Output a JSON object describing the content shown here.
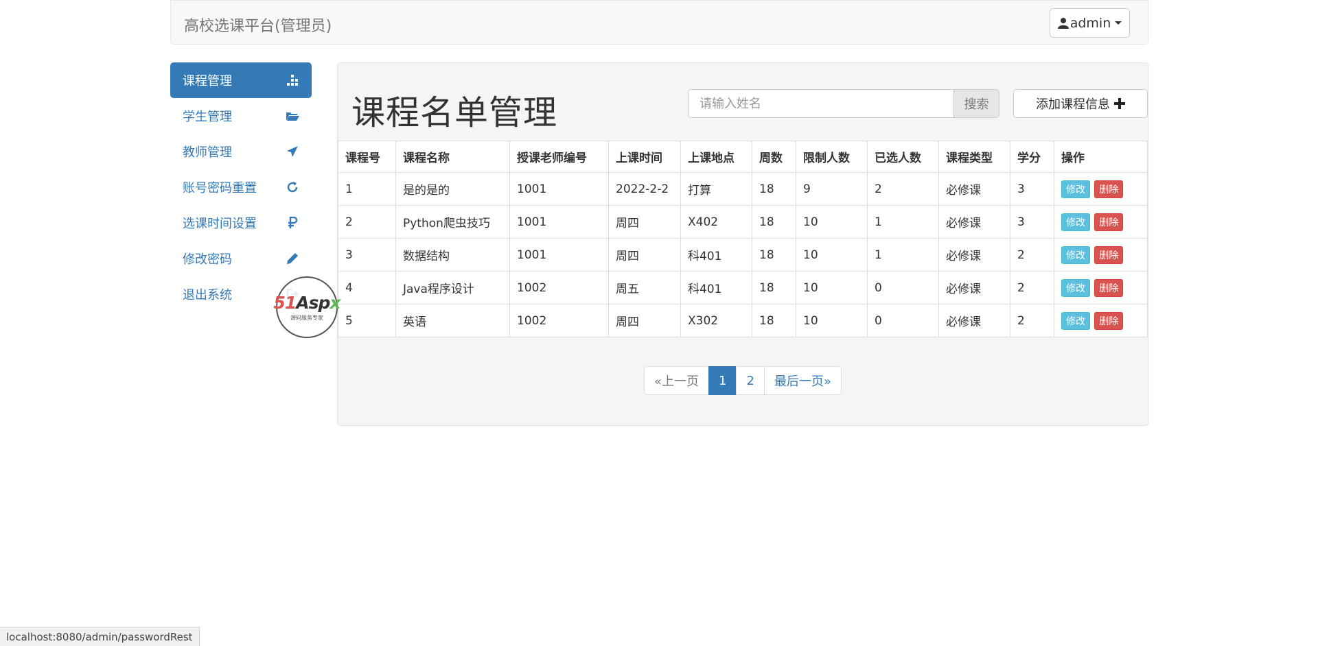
{
  "navbar": {
    "brand": "高校选课平台(管理员)",
    "user_label": "admin"
  },
  "sidebar": {
    "items": [
      {
        "label": "课程管理",
        "icon": "sitemap-icon",
        "active": true
      },
      {
        "label": "学生管理",
        "icon": "folder-open-icon"
      },
      {
        "label": "教师管理",
        "icon": "send-icon"
      },
      {
        "label": "账号密码重置",
        "icon": "refresh-icon"
      },
      {
        "label": "选课时间设置",
        "icon": "ruble-icon"
      },
      {
        "label": "修改密码",
        "icon": "pencil-icon"
      },
      {
        "label": "退出系统",
        "icon": "log-out-icon"
      }
    ]
  },
  "main": {
    "title": "课程名单管理",
    "search": {
      "placeholder": "请输入姓名",
      "value": "",
      "button": "搜索"
    },
    "add_button": "添加课程信息",
    "table": {
      "headers": [
        "课程号",
        "课程名称",
        "授课老师编号",
        "上课时间",
        "上课地点",
        "周数",
        "限制人数",
        "已选人数",
        "课程类型",
        "学分",
        "操作"
      ],
      "rows": [
        [
          "1",
          "是的是的",
          "1001",
          "2022-2-2",
          "打算",
          "18",
          "9",
          "2",
          "必修课",
          "3"
        ],
        [
          "2",
          "Python爬虫技巧",
          "1001",
          "周四",
          "X402",
          "18",
          "10",
          "1",
          "必修课",
          "3"
        ],
        [
          "3",
          "数据结构",
          "1001",
          "周四",
          "科401",
          "18",
          "10",
          "1",
          "必修课",
          "2"
        ],
        [
          "4",
          "Java程序设计",
          "1002",
          "周五",
          "科401",
          "18",
          "10",
          "0",
          "必修课",
          "2"
        ],
        [
          "5",
          "英语",
          "1002",
          "周四",
          "X302",
          "18",
          "10",
          "0",
          "必修课",
          "2"
        ]
      ],
      "edit_label": "修改",
      "delete_label": "删除"
    },
    "pagination": {
      "prev": "«上一页",
      "pages": [
        "1",
        "2"
      ],
      "current": "1",
      "last": "最后一页»"
    }
  },
  "status_bar": {
    "url": "localhost:8080/admin/passwordRest"
  },
  "watermark": {
    "logo_a": "51",
    "logo_b": "Asp",
    "logo_c": "x",
    "sub": "源码服务专家"
  },
  "colors": {
    "primary": "#337ab7",
    "info": "#5bc0de",
    "danger": "#d9534f",
    "panel_bg": "#f5f5f5"
  }
}
